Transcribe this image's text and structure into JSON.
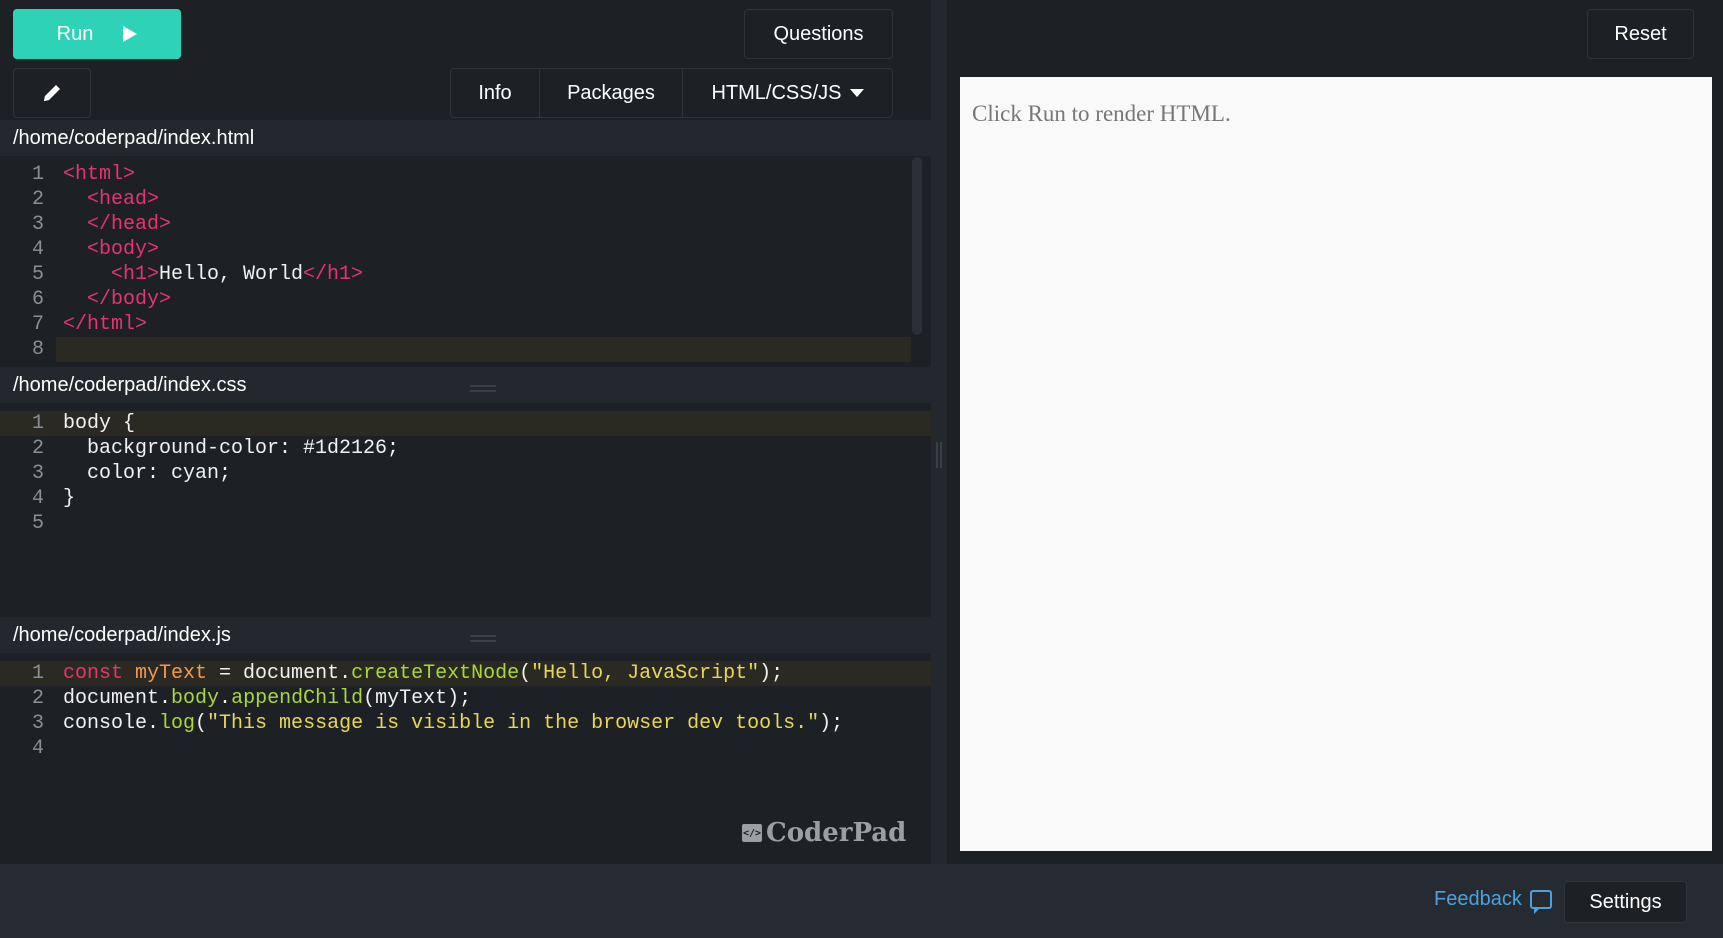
{
  "toolbar": {
    "run_label": "Run",
    "questions_label": "Questions",
    "tabs": [
      "Info",
      "Packages",
      "HTML/CSS/JS"
    ]
  },
  "editors": [
    {
      "path": "/home/coderpad/index.html",
      "lines": [
        "1",
        "2",
        "3",
        "4",
        "5",
        "6",
        "7",
        "8"
      ]
    },
    {
      "path": "/home/coderpad/index.css",
      "lines": [
        "1",
        "2",
        "3",
        "4",
        "5"
      ]
    },
    {
      "path": "/home/coderpad/index.js",
      "lines": [
        "1",
        "2",
        "3",
        "4"
      ]
    }
  ],
  "code": {
    "html": [
      [
        "<html>"
      ],
      [
        "  <head>"
      ],
      [
        "  </head>"
      ],
      [
        "  <body>"
      ],
      [
        "    <h1>",
        "Hello, World",
        "</h1>"
      ],
      [
        "  </body>"
      ],
      [
        "</html>"
      ],
      [
        ""
      ]
    ],
    "css": [
      "body {",
      "  background-color: #1d2126;",
      "  color: cyan;",
      "}",
      ""
    ],
    "js": {
      "l1": [
        "const",
        " ",
        "myText",
        " = document.",
        "createTextNode",
        "(",
        "\"Hello, JavaScript\"",
        ");"
      ],
      "l2": [
        "document.",
        "body",
        ".",
        "appendChild",
        "(myText);"
      ],
      "l3": [
        "console.",
        "log",
        "(",
        "\"This message is visible in the browser dev tools.\"",
        ");"
      ],
      "l4": ""
    }
  },
  "logo": {
    "mark": "</>",
    "text": "CoderPad"
  },
  "preview": {
    "reset_label": "Reset",
    "placeholder": "Click Run to render HTML."
  },
  "footer": {
    "feedback_label": "Feedback",
    "settings_label": "Settings"
  },
  "colors": {
    "accent": "#2ed3b7",
    "background": "#1d2126",
    "tag": "#e8336e",
    "function": "#a8d83a",
    "string": "#e8d65a",
    "link": "#4aa3df"
  },
  "icons": [
    "play-icon",
    "pencil-icon",
    "caret-down-icon",
    "chat-bubble-icon",
    "coderpad-logo-icon"
  ]
}
